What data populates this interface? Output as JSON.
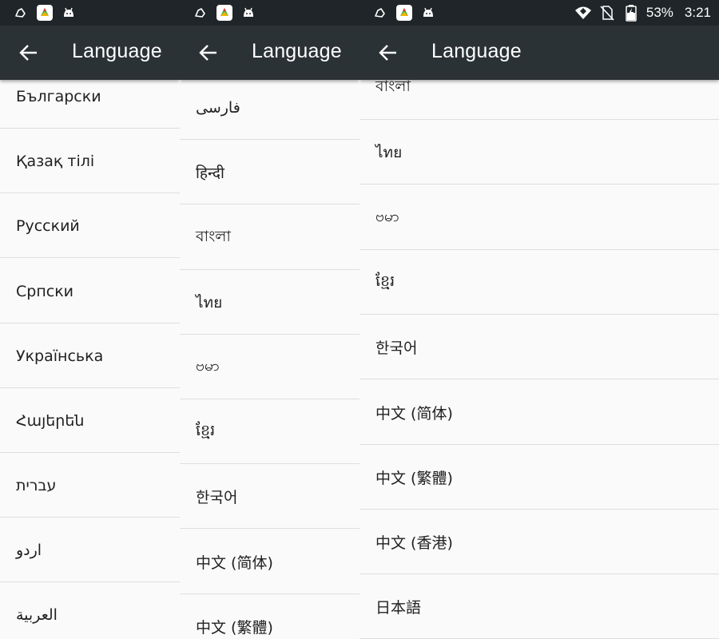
{
  "screens": [
    {
      "title": "Language",
      "items": [
        "Български",
        "Қазақ тілі",
        "Русский",
        "Српски",
        "Українська",
        "Հայերեն",
        "עברית",
        "اردو",
        "العربية"
      ]
    },
    {
      "title": "Language",
      "items": [
        "فارسی",
        "हिन्दी",
        "বাংলা",
        "ไทย",
        "ဗမာ",
        "ខ្មែរ",
        "한국어",
        "中文 (简体)",
        "中文 (繁體)"
      ]
    },
    {
      "title": "Language",
      "items": [
        "বাংলা",
        "ไทย",
        "ဗမာ",
        "ខ្មែរ",
        "한국어",
        "中文 (简体)",
        "中文 (繁體)",
        "中文 (香港)",
        "日本語"
      ]
    }
  ],
  "status": {
    "battery_percent": "53%",
    "time": "3:21"
  },
  "colors": {
    "appbar": "#2b3236",
    "statusbar": "#1f2528",
    "background": "#fafafa",
    "divider": "#dedede"
  }
}
